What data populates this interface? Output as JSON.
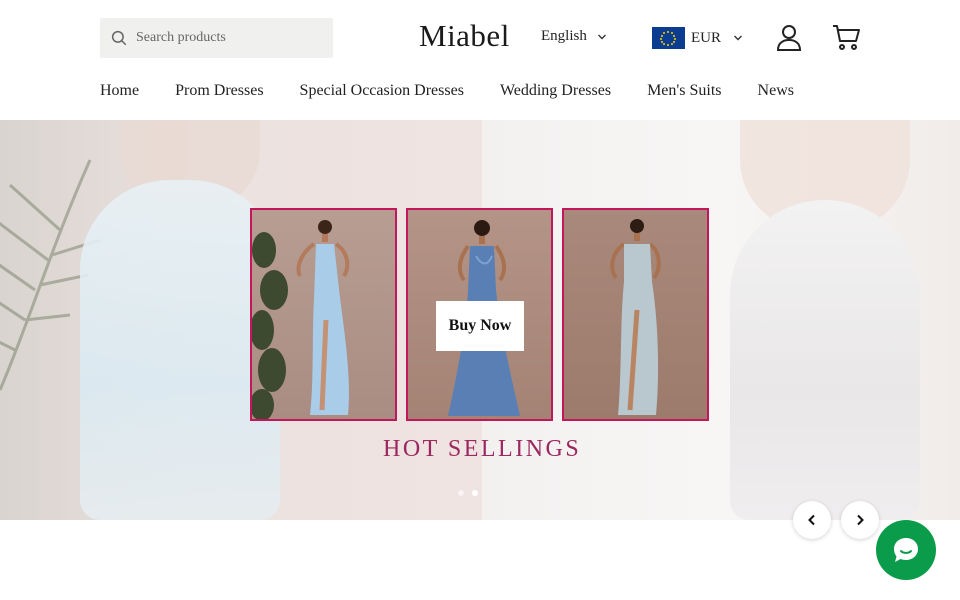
{
  "header": {
    "search_placeholder": "Search products",
    "logo": "Miabel",
    "language": "English",
    "currency": "EUR"
  },
  "nav": [
    "Home",
    "Prom Dresses",
    "Special Occasion Dresses",
    "Wedding Dresses",
    "Men's Suits",
    "News"
  ],
  "banner": {
    "cta": "Buy Now",
    "title": "HOT SELLINGS",
    "slides_total": 2,
    "active_slide": 2
  },
  "icons": {
    "search": "search-icon",
    "account": "user-icon",
    "cart": "cart-icon",
    "prev": "chevron-left-icon",
    "next": "chevron-right-icon",
    "chat": "chat-bubble-icon"
  },
  "colors": {
    "accent": "#c2185b",
    "title": "#9c2860",
    "chat": "#0b9c4b",
    "flag": "#0a3d91"
  }
}
